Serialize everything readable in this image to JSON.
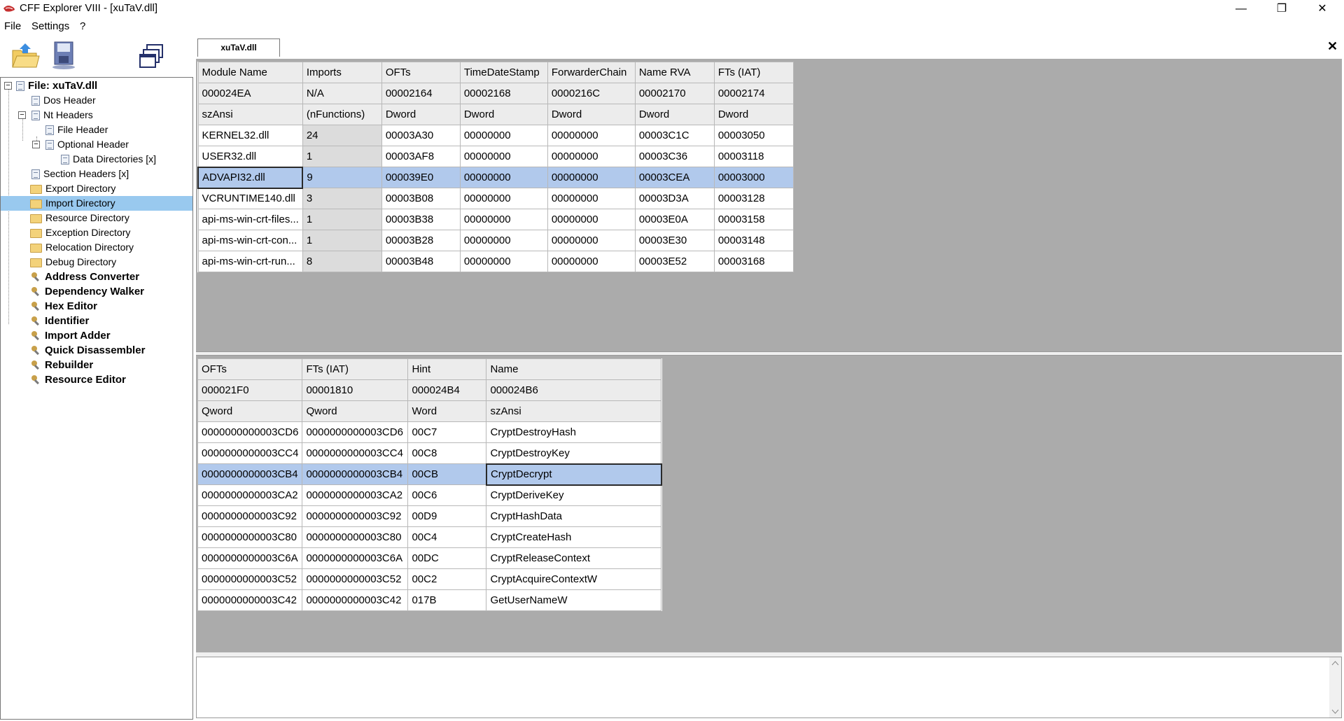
{
  "window": {
    "title": "CFF Explorer VIII - [xuTaV.dll]",
    "minimize": "—",
    "restore": "❐",
    "close": "✕"
  },
  "menu": [
    "File",
    "Settings",
    "?"
  ],
  "tab": {
    "label": "xuTaV.dll",
    "close": "✕"
  },
  "tree": {
    "root": "File: xuTaV.dll",
    "items": [
      "Dos Header",
      "Nt Headers",
      "File Header",
      "Optional Header",
      "Data Directories [x]",
      "Section Headers [x]",
      "Export Directory",
      "Import Directory",
      "Resource Directory",
      "Exception Directory",
      "Relocation Directory",
      "Debug Directory"
    ],
    "tools": [
      "Address Converter",
      "Dependency Walker",
      "Hex Editor",
      "Identifier",
      "Import Adder",
      "Quick Disassembler",
      "Rebuilder",
      "Resource Editor"
    ]
  },
  "modules": {
    "columns": [
      "Module Name",
      "Imports",
      "OFTs",
      "TimeDateStamp",
      "ForwarderChain",
      "Name RVA",
      "FTs (IAT)"
    ],
    "offsets": [
      "000024EA",
      "N/A",
      "00002164",
      "00002168",
      "0000216C",
      "00002170",
      "00002174"
    ],
    "types": [
      "szAnsi",
      "(nFunctions)",
      "Dword",
      "Dword",
      "Dword",
      "Dword",
      "Dword"
    ],
    "rows": [
      [
        "KERNEL32.dll",
        "24",
        "00003A30",
        "00000000",
        "00000000",
        "00003C1C",
        "00003050"
      ],
      [
        "USER32.dll",
        "1",
        "00003AF8",
        "00000000",
        "00000000",
        "00003C36",
        "00003118"
      ],
      [
        "ADVAPI32.dll",
        "9",
        "000039E0",
        "00000000",
        "00000000",
        "00003CEA",
        "00003000"
      ],
      [
        "VCRUNTIME140.dll",
        "3",
        "00003B08",
        "00000000",
        "00000000",
        "00003D3A",
        "00003128"
      ],
      [
        "api-ms-win-crt-files...",
        "1",
        "00003B38",
        "00000000",
        "00000000",
        "00003E0A",
        "00003158"
      ],
      [
        "api-ms-win-crt-con...",
        "1",
        "00003B28",
        "00000000",
        "00000000",
        "00003E30",
        "00003148"
      ],
      [
        "api-ms-win-crt-run...",
        "8",
        "00003B48",
        "00000000",
        "00000000",
        "00003E52",
        "00003168"
      ]
    ]
  },
  "functions": {
    "columns": [
      "OFTs",
      "FTs (IAT)",
      "Hint",
      "Name"
    ],
    "offsets": [
      "000021F0",
      "00001810",
      "000024B4",
      "000024B6"
    ],
    "types": [
      "Qword",
      "Qword",
      "Word",
      "szAnsi"
    ],
    "rows": [
      [
        "0000000000003CD6",
        "0000000000003CD6",
        "00C7",
        "CryptDestroyHash"
      ],
      [
        "0000000000003CC4",
        "0000000000003CC4",
        "00C8",
        "CryptDestroyKey"
      ],
      [
        "0000000000003CB4",
        "0000000000003CB4",
        "00CB",
        "CryptDecrypt"
      ],
      [
        "0000000000003CA2",
        "0000000000003CA2",
        "00C6",
        "CryptDeriveKey"
      ],
      [
        "0000000000003C92",
        "0000000000003C92",
        "00D9",
        "CryptHashData"
      ],
      [
        "0000000000003C80",
        "0000000000003C80",
        "00C4",
        "CryptCreateHash"
      ],
      [
        "0000000000003C6A",
        "0000000000003C6A",
        "00DC",
        "CryptReleaseContext"
      ],
      [
        "0000000000003C52",
        "0000000000003C52",
        "00C2",
        "CryptAcquireContextW"
      ],
      [
        "0000000000003C42",
        "0000000000003C42",
        "017B",
        "GetUserNameW"
      ]
    ]
  }
}
